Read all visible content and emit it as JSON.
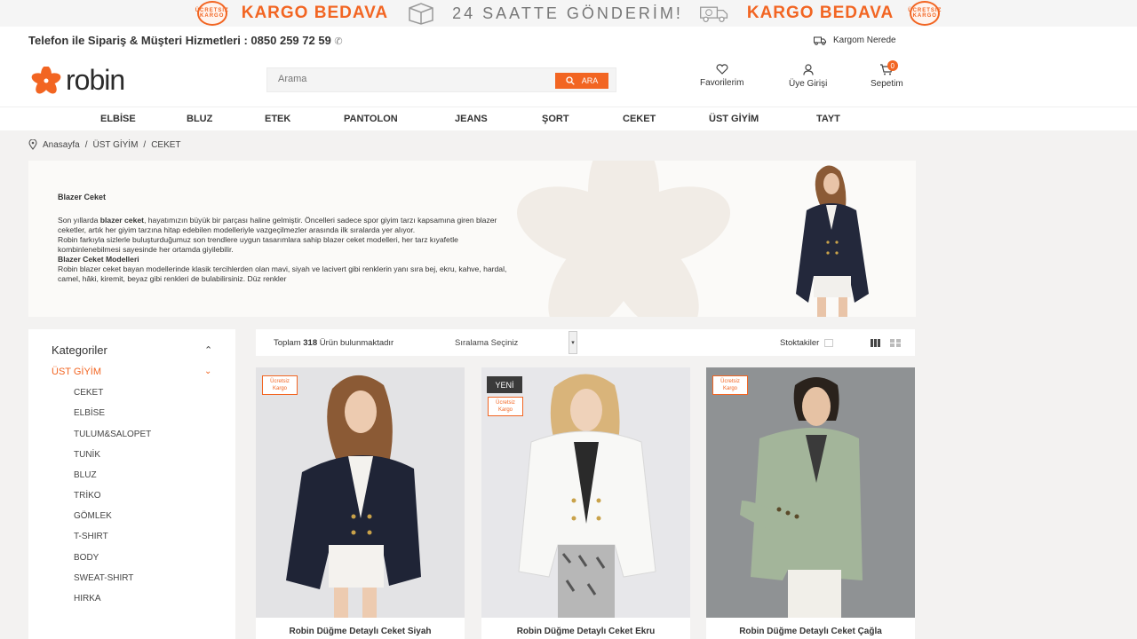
{
  "promo": {
    "badge_text": "ÜCRETSİZ KARGO",
    "kargo_left": "KARGO BEDAVA",
    "shipping_24": "24 SAATTE GÖNDERİM!",
    "kargo_right": "KARGO BEDAVA"
  },
  "infobar": {
    "phone": "Telefon ile Sipariş & Müşteri Hizmetleri : 0850 259 72 59",
    "track": "Kargom Nerede"
  },
  "header": {
    "logo": "robin",
    "search_placeholder": "Arama",
    "search_button": "ARA",
    "favorites": "Favorilerim",
    "login": "Üye Girişi",
    "cart": "Sepetim",
    "cart_count": "0"
  },
  "nav": [
    "ELBİSE",
    "BLUZ",
    "ETEK",
    "PANTOLON",
    "JEANS",
    "ŞORT",
    "CEKET",
    "ÜST GİYİM",
    "TAYT"
  ],
  "breadcrumb": [
    "Anasayfa",
    "/",
    "ÜST GİYİM",
    "/",
    "CEKET"
  ],
  "hero": {
    "title": "Blazer Ceket",
    "p1_pre": "Son yıllarda ",
    "p1_bold": "blazer ceket",
    "p1_post": ", hayatımızın büyük bir parçası haline gelmiştir. Öncelleri sadece spor giyim tarzı kapsamına giren blazer ceketler, artık her giyim tarzına hitap edebilen modelleriyle vazgeçilmezler arasında ilk sıralarda yer alıyor.",
    "p2": "Robin farkıyla sizlerle buluşturduğumuz son trendlere uygun tasarımlara sahip blazer ceket modelleri, her tarz kıyafetle kombinlenebilmesi sayesinde her ortamda giyilebilir.",
    "subtitle": "Blazer Ceket Modelleri",
    "p3": "Robin blazer ceket bayan modellerinde klasik tercihlerden olan mavi, siyah ve lacivert gibi renklerin yanı sıra bej, ekru, kahve, hardal, camel, hâki, kiremit, beyaz gibi renkleri de bulabilirsiniz. Düz renkler"
  },
  "sidebar": {
    "heading": "Kategoriler",
    "active": "ÜST GİYİM",
    "items": [
      "CEKET",
      "ELBİSE",
      "TULUM&SALOPET",
      "TUNİK",
      "BLUZ",
      "TRİKO",
      "GÖMLEK",
      "T-SHIRT",
      "BODY",
      "SWEAT-SHIRT",
      "HIRKA"
    ]
  },
  "toolbar": {
    "total_pre": "Toplam",
    "total_count": "318",
    "total_post": "Ürün bulunmaktadır",
    "sort": "Sıralama Seçiniz",
    "stock": "Stoktakiler"
  },
  "products": [
    {
      "name": "Robin Düğme Detaylı Ceket Siyah",
      "badge": "Ücretsiz Kargo",
      "new": ""
    },
    {
      "name": "Robin Düğme Detaylı Ceket Ekru",
      "badge": "Ücretsiz Kargo",
      "new": "YENİ"
    },
    {
      "name": "Robin Düğme Detaylı Ceket Çağla",
      "badge": "Ücretsiz Kargo",
      "new": ""
    }
  ],
  "colors": {
    "accent": "#f26522",
    "text": "#333333",
    "page_bg": "#f3f2f1"
  }
}
